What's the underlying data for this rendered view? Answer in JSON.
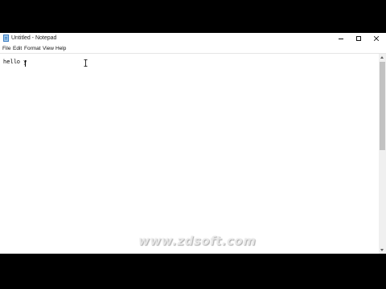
{
  "window": {
    "title": "Untitled - Notepad",
    "app_icon": "notepad-icon",
    "controls": {
      "minimize": "minimize-icon",
      "maximize": "maximize-icon",
      "close": "close-icon"
    }
  },
  "menu": {
    "file": "File",
    "edit": "Edit",
    "format": "Format",
    "view": "View",
    "help": "Help"
  },
  "editor": {
    "content": "hello y",
    "cursor_icon": "text-cursor-icon"
  },
  "scrollbar": {
    "up_icon": "scroll-up-arrow-icon",
    "down_icon": "scroll-down-arrow-icon"
  },
  "watermark": {
    "text": "www.zdsoft.com"
  },
  "colors": {
    "desktop_background": "#000000",
    "window_background": "#ffffff",
    "scrollbar_track": "#f0f0f0",
    "scrollbar_thumb": "#c2c2c2"
  }
}
